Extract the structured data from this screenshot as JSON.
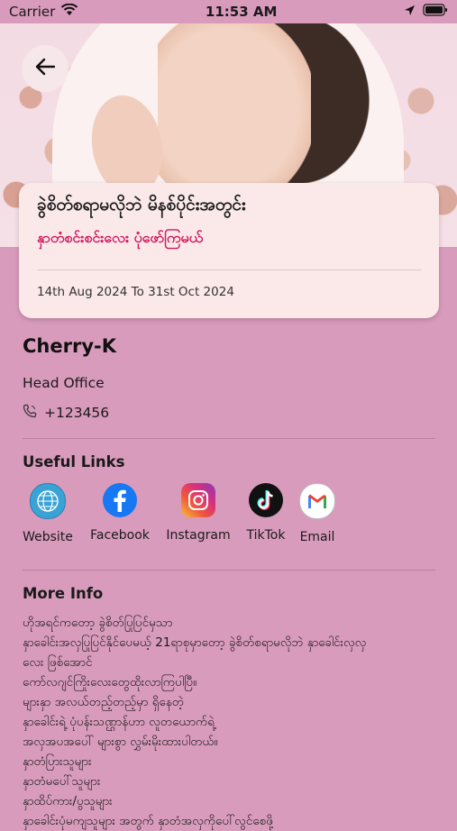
{
  "status_bar": {
    "carrier": "Carrier",
    "time": "11:53 AM"
  },
  "hero": {
    "back_icon": "arrow-left-icon"
  },
  "promo": {
    "title": "ခွဲစိတ်စရာမလိုဘဲ မိနစ်ပိုင်းအတွင်း",
    "subtitle": "နှာတံစင်းစင်းလေး ပုံဖော်ကြမယ်",
    "date_range": "14th Aug 2024 To 31st Oct 2024",
    "subtitle_color": "#d0195f"
  },
  "profile": {
    "name": "Cherry-K",
    "branch": "Head Office",
    "phone": "+123456",
    "phone_icon": "phone-icon"
  },
  "useful_links": {
    "title": "Useful Links",
    "items": [
      {
        "label": "Website",
        "icon": "globe-icon"
      },
      {
        "label": "Facebook",
        "icon": "facebook-icon"
      },
      {
        "label": "Instagram",
        "icon": "instagram-icon"
      },
      {
        "label": "TikTok",
        "icon": "tiktok-icon"
      },
      {
        "label": "Email",
        "icon": "gmail-icon"
      }
    ]
  },
  "more_info": {
    "title": "More Info",
    "lines": [
      "ဟိုအရင်ကတော့ ခွဲစိတ်ပြုပြင်မှသာ",
      "နှာခေါင်းအလှပြုပြင်နိုင်ပေမယ့် 21ရာစုမှာတော့ ခွဲစိတ်စရာမလိုဘဲ နှာခေါင်းလှလှ",
      "လေး ဖြစ်အောင်",
      "ကော်လဂျင်ကြိုးလေးတွေထိုးလာကြပါပြီ။",
      "များနှာ အလယ်တည့်တည့်မှာ ရှိနေတဲ့",
      "နှာခေါင်းရဲ့ ပုံပန်းသဏ္ဌာန်ဟာ လူတယောက်ရဲ့",
      "အလှအပအပေါ် များစွာ လွှမ်းမိုးထားပါတယ်။",
      "နှာတံပြားသူများ",
      "နှာတံမပေါ်သူများ",
      "နှာထိပ်ကား/ပွသူများ",
      "နှာခေါင်းပုံမကျသူများ အတွက် နှာတံအလှကိုပေါ်လွင်စေဖို့"
    ]
  },
  "colors": {
    "background": "#d99bbc",
    "card": "#fbe9ea",
    "accent": "#d0195f"
  }
}
